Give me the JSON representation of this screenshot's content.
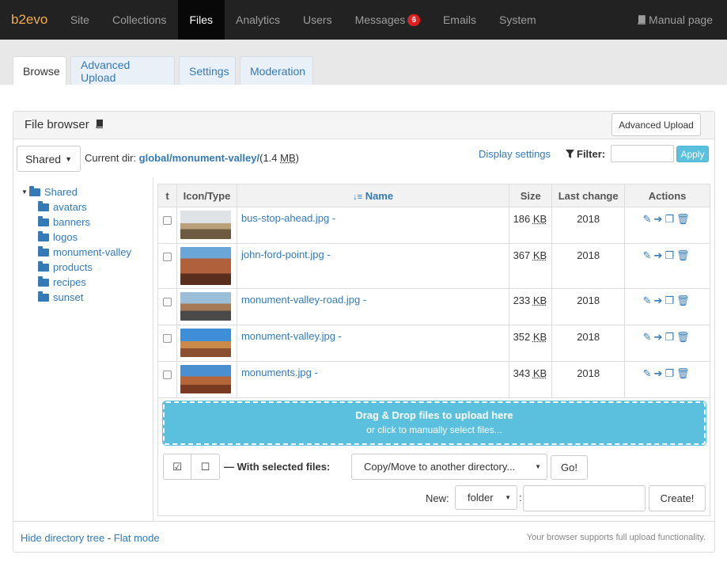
{
  "navbar": {
    "brand": "b2evo",
    "items": [
      "Site",
      "Collections",
      "Files",
      "Analytics",
      "Users",
      "Messages",
      "Emails",
      "System"
    ],
    "messages_badge": "6",
    "manual": "Manual page"
  },
  "tabs": [
    "Browse",
    "Advanced Upload",
    "Settings",
    "Moderation"
  ],
  "panel": {
    "title": "File browser",
    "advanced_upload_btn": "Advanced Upload",
    "shared_btn": "Shared",
    "current_dir_label": "Current dir:",
    "dir_global": "global",
    "dir_sub": "monument-valley",
    "dir_size_open": "(1.4 ",
    "dir_size_unit": "MB",
    "dir_size_close": ")",
    "display_settings": "Display settings",
    "filter_label": "Filter:",
    "apply": "Apply"
  },
  "tree": [
    "Shared",
    "avatars",
    "banners",
    "logos",
    "monument-valley",
    "products",
    "recipes",
    "sunset"
  ],
  "table": {
    "headers": {
      "t": "t",
      "icon": "Icon/Type",
      "name": "Name",
      "size": "Size",
      "change": "Last change",
      "actions": "Actions"
    },
    "rows": [
      {
        "name": "bus-stop-ahead.jpg",
        "suffix": " -",
        "size": "186",
        "unit": "KB",
        "change": "2018"
      },
      {
        "name": "john-ford-point.jpg",
        "suffix": " -",
        "size": "367",
        "unit": "KB",
        "change": "2018"
      },
      {
        "name": "monument-valley-road.jpg",
        "suffix": " -",
        "size": "233",
        "unit": "KB",
        "change": "2018"
      },
      {
        "name": "monument-valley.jpg",
        "suffix": " -",
        "size": "352",
        "unit": "KB",
        "change": "2018"
      },
      {
        "name": "monuments.jpg",
        "suffix": " -",
        "size": "343",
        "unit": "KB",
        "change": "2018"
      }
    ]
  },
  "dropzone": {
    "line1": "Drag & Drop files to upload here",
    "line2": "or click to manually select files..."
  },
  "actions_bar": {
    "with_selected": "— With selected files:",
    "select_value": "Copy/Move to another directory...",
    "go": "Go!",
    "new_label": "New:",
    "new_type": "folder",
    "create": "Create!"
  },
  "footer": {
    "hide_tree": "Hide directory tree",
    "sep": " - ",
    "flat_mode": "Flat mode",
    "support": "Your browser supports full upload functionality."
  }
}
